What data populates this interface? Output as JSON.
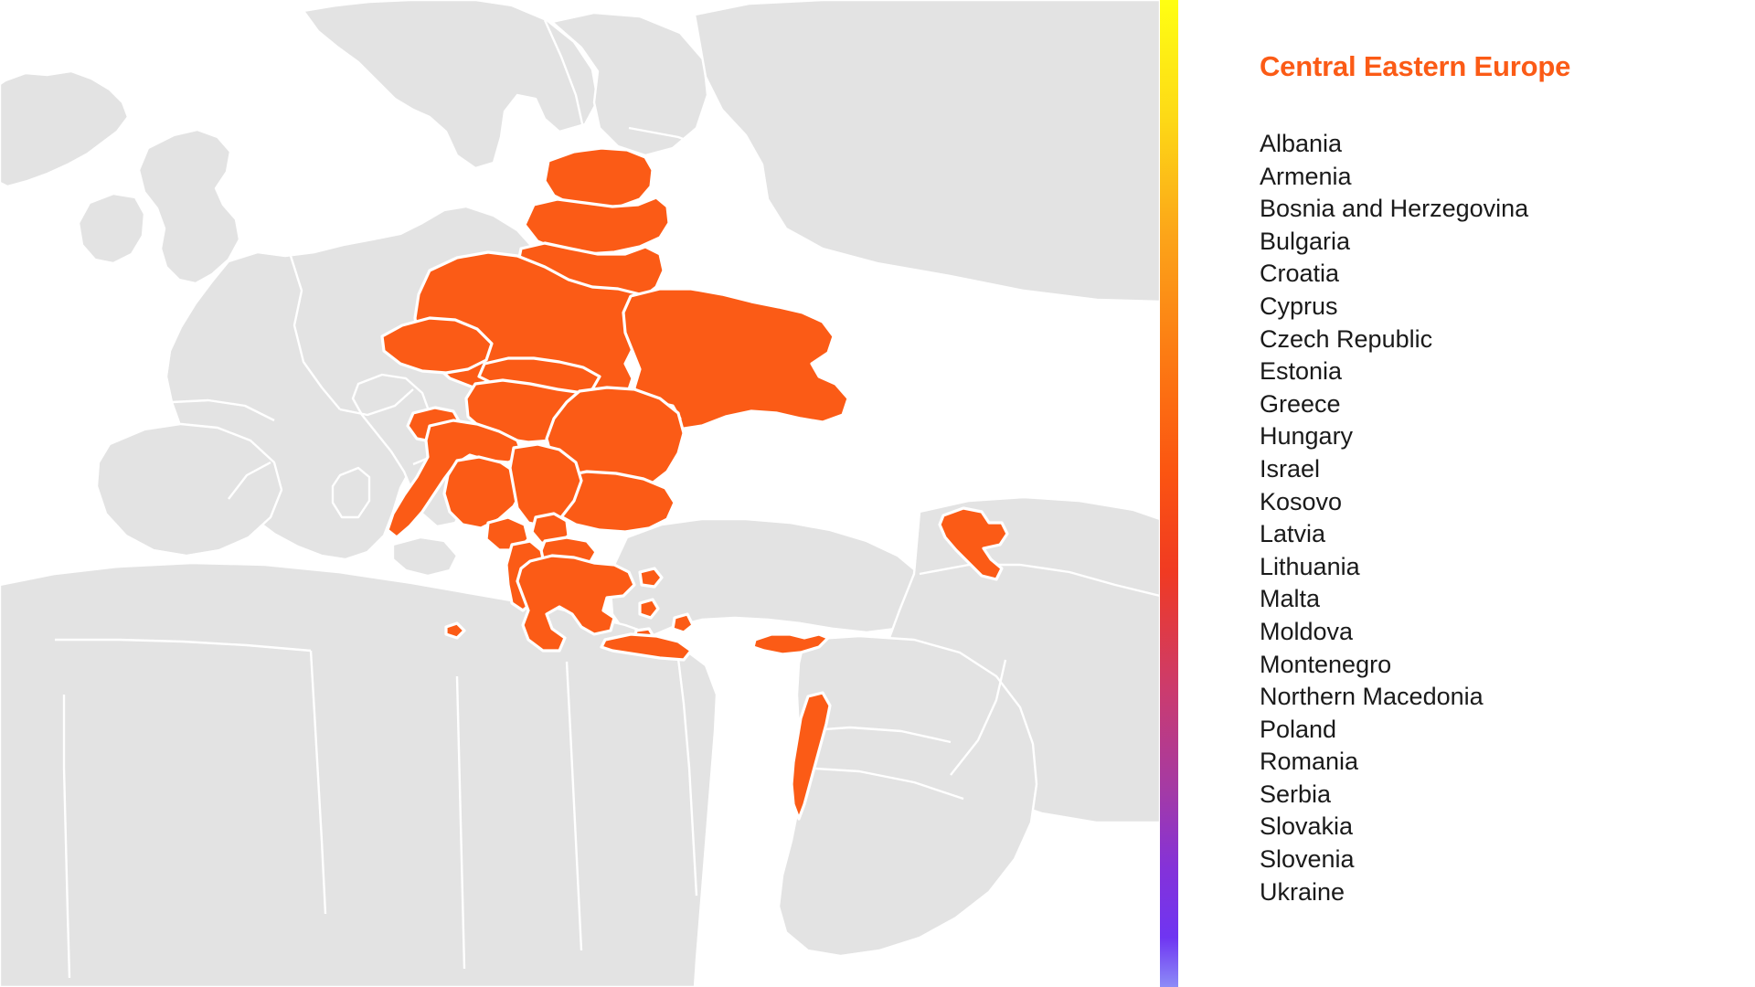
{
  "panel": {
    "title": "Central Eastern Europe",
    "title_color": "#FB5B16",
    "text_color": "#1a1a1a",
    "background": "#ffffff"
  },
  "countries": [
    "Albania",
    "Armenia",
    "Bosnia and Herzegovina",
    "Bulgaria",
    "Croatia",
    "Cyprus",
    "Czech Republic",
    "Estonia",
    "Greece",
    "Hungary",
    "Israel",
    "Kosovo",
    "Latvia",
    "Lithuania",
    "Malta",
    "Moldova",
    "Montenegro",
    "Northern Macedonia",
    "Poland",
    "Romania",
    "Serbia",
    "Slovakia",
    "Slovenia",
    "Ukraine"
  ],
  "map": {
    "highlight_color": "#FB5B16",
    "land_color": "#E3E3E3",
    "sea_color": "#ffffff",
    "border_color": "#ffffff",
    "region_label": "Central Eastern Europe"
  },
  "gradient_bar": {
    "name": "colormap-scale",
    "stops": [
      {
        "pos": 0,
        "color": "#FFFF12"
      },
      {
        "pos": 12,
        "color": "#FDD916"
      },
      {
        "pos": 24,
        "color": "#FCA419"
      },
      {
        "pos": 36,
        "color": "#FC7B13"
      },
      {
        "pos": 48,
        "color": "#FB5411"
      },
      {
        "pos": 58,
        "color": "#F03A22"
      },
      {
        "pos": 70,
        "color": "#CB3B6E"
      },
      {
        "pos": 80,
        "color": "#A43AA5"
      },
      {
        "pos": 88,
        "color": "#8432D9"
      },
      {
        "pos": 95,
        "color": "#6F35F2"
      },
      {
        "pos": 100,
        "color": "#8C8CF7"
      }
    ]
  }
}
